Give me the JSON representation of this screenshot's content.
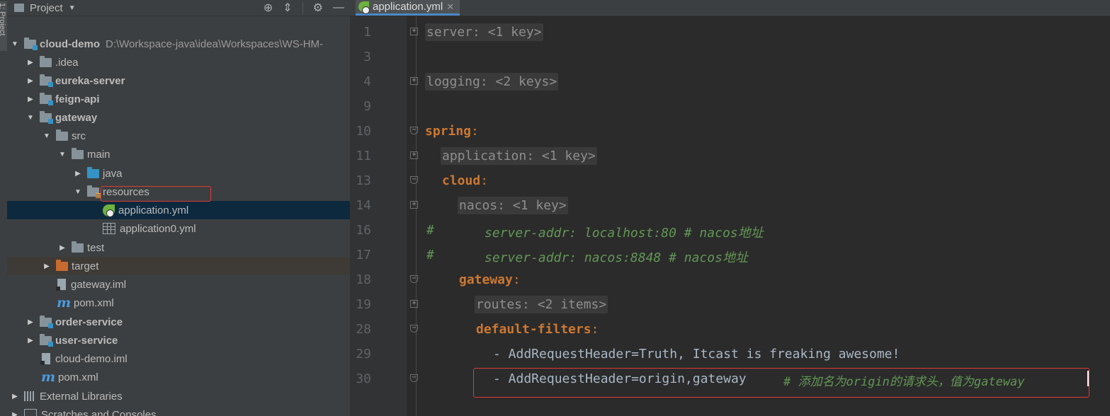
{
  "toolwindow": {
    "vertical_label": "1: Project"
  },
  "project_panel": {
    "title": "Project",
    "tools": [
      "target-icon",
      "collapse-icon",
      "gear-icon",
      "minimize-icon"
    ],
    "root": {
      "name": "cloud-demo",
      "path": "D:\\Workspace-java\\idea\\Workspaces\\WS-HM-"
    },
    "items": {
      "idea": ".idea",
      "eureka": "eureka-server",
      "feign": "feign-api",
      "gateway": "gateway",
      "src": "src",
      "main": "main",
      "java": "java",
      "resources": "resources",
      "app_yml": "application.yml",
      "app0_yml": "application0.yml",
      "test": "test",
      "target": "target",
      "gateway_iml": "gateway.iml",
      "gateway_pom": "pom.xml",
      "order": "order-service",
      "user": "user-service",
      "cloud_iml": "cloud-demo.iml",
      "root_pom": "pom.xml",
      "ext_libs": "External Libraries",
      "scratches": "Scratches and Consoles"
    }
  },
  "editor": {
    "tab_label": "application.yml",
    "lines": [
      {
        "num": "1",
        "text": "server: <1 key>"
      },
      {
        "num": "3",
        "text": ""
      },
      {
        "num": "4",
        "text": "logging: <2 keys>"
      },
      {
        "num": "9",
        "text": ""
      },
      {
        "num": "10",
        "key": "spring",
        "punct": ":"
      },
      {
        "num": "11",
        "text": "application: <1 key>"
      },
      {
        "num": "13",
        "key": "cloud",
        "punct": ":"
      },
      {
        "num": "14",
        "text": "nacos: <1 key>"
      },
      {
        "num": "16",
        "hash": "#",
        "comment": "server-addr: localhost:80 # nacos地址"
      },
      {
        "num": "17",
        "hash": "#",
        "comment": "server-addr: nacos:8848 # nacos地址"
      },
      {
        "num": "18",
        "key": "gateway",
        "punct": ":"
      },
      {
        "num": "19",
        "text": "routes: <2 items>"
      },
      {
        "num": "28",
        "key": "default-filters",
        "punct": ":"
      },
      {
        "num": "29",
        "text": "- AddRequestHeader=Truth, Itcast is freaking awesome!"
      },
      {
        "num": "30",
        "text": "- AddRequestHeader=origin,gateway",
        "comment": "# 添加名为origin的请求头，值为gateway"
      }
    ]
  },
  "colors": {
    "keyword": "#cc7832",
    "comment": "#629755",
    "text": "#a9b7c6",
    "selection": "#0d293e",
    "highlight_box": "#e03a3a"
  }
}
